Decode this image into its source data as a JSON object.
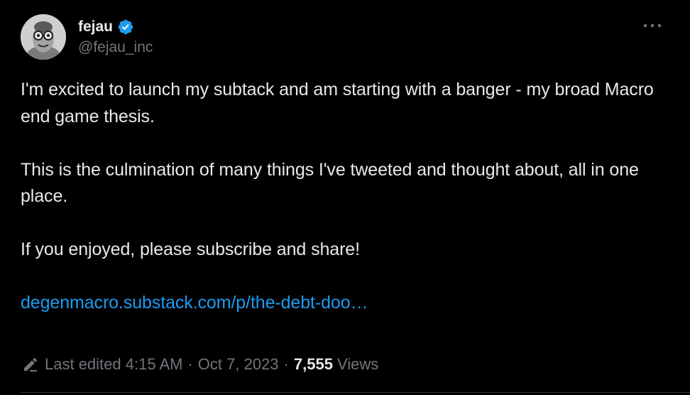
{
  "author": {
    "display_name": "fejau",
    "handle": "@fejau_inc",
    "verified": true,
    "avatar_icon": "avatar-image-icon"
  },
  "tweet": {
    "paragraphs": [
      "I'm excited to launch my subtack and am starting with a banger - my broad Macro end game thesis.",
      "This is the culmination of many things I've tweeted and thought about, all in one place.",
      "If you enjoyed, please subscribe and share!"
    ],
    "link_text": "degenmacro.substack.com/p/the-debt-doo…"
  },
  "meta": {
    "edited_label": "Last edited 4:15 AM",
    "date": "Oct 7, 2023",
    "separator": "·",
    "views_count": "7,555",
    "views_label": "Views"
  },
  "colors": {
    "background": "#000000",
    "text": "#e7e9ea",
    "muted": "#71767b",
    "link": "#1d9bf0",
    "verified_badge": "#1d9bf0"
  }
}
